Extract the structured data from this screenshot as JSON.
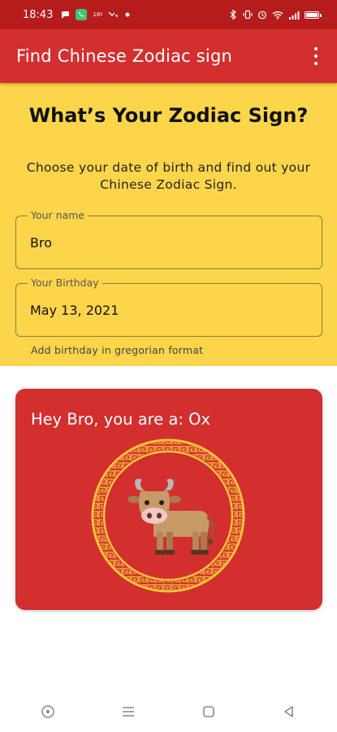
{
  "status_bar": {
    "time": "18:43",
    "left_icons": [
      "chat-icon",
      "whatsapp-icon",
      "data-icon",
      "missed-call-icon",
      "dot-icon"
    ],
    "right_icons": [
      "bluetooth-icon",
      "vibrate-icon",
      "alarm-icon",
      "wifi-icon",
      "signal-icon",
      "battery-icon"
    ]
  },
  "app_bar": {
    "title": "Find Chinese Zodiac sign",
    "menu_icon": "more-vert-icon"
  },
  "form": {
    "heading": "What’s Your Zodiac Sign?",
    "subtitle": "Choose your date of birth and find out your Chinese Zodiac Sign.",
    "name_label": "Your name",
    "name_value": "Bro",
    "birthday_label": "Your Birthday",
    "birthday_value": "May 13, 2021",
    "birthday_helper": "Add birthday in gregorian format"
  },
  "result": {
    "text": "Hey Bro, you are a: Ox",
    "sign_icon": "ox-icon"
  },
  "colors": {
    "status_bar": "#b71c1c",
    "app_bar": "#d32f2f",
    "form_background": "#fdd54a",
    "card": "#d32f2f",
    "emblem_gold": "#f3c53c"
  },
  "nav_bar": {
    "icons": [
      "assistant-icon",
      "recents-icon",
      "home-icon",
      "back-icon"
    ]
  }
}
